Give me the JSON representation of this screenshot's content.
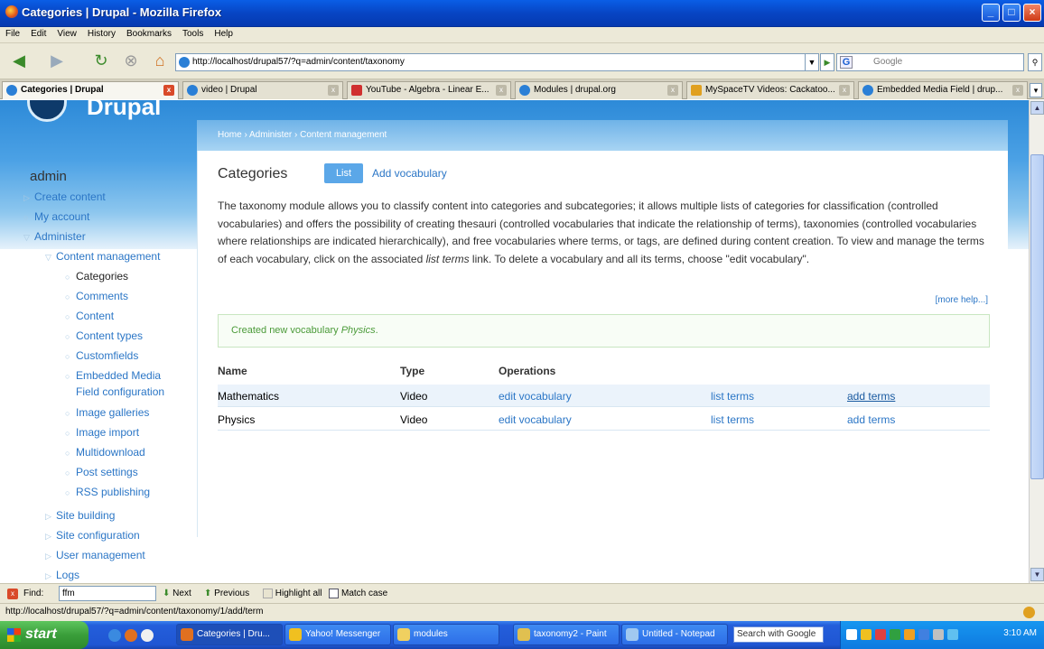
{
  "window": {
    "title": "Categories | Drupal - Mozilla Firefox"
  },
  "menu": [
    "File",
    "Edit",
    "View",
    "History",
    "Bookmarks",
    "Tools",
    "Help"
  ],
  "url": "http://localhost/drupal57/?q=admin/content/taxonomy",
  "search_placeholder": "Google",
  "tabs": [
    {
      "label": "Categories | Drupal"
    },
    {
      "label": "video | Drupal"
    },
    {
      "label": "YouTube - Algebra - Linear E..."
    },
    {
      "label": "Modules | drupal.org"
    },
    {
      "label": "MySpaceTV Videos: Cackatoo..."
    },
    {
      "label": "Embedded Media Field | drup..."
    }
  ],
  "site": {
    "logo_text": "Drupal"
  },
  "breadcrumb": "Home › Administer › Content management",
  "sidebar": {
    "user": "admin",
    "items": [
      {
        "label": "Create content"
      },
      {
        "label": "My account"
      },
      {
        "label": "Administer"
      },
      {
        "label": "Content management"
      },
      {
        "label": "Categories"
      },
      {
        "label": "Comments"
      },
      {
        "label": "Content"
      },
      {
        "label": "Content types"
      },
      {
        "label": "Customfields"
      },
      {
        "label": "Embedded Media"
      },
      {
        "label": "Field configuration"
      },
      {
        "label": "Image galleries"
      },
      {
        "label": "Image import"
      },
      {
        "label": "Multidownload"
      },
      {
        "label": "Post settings"
      },
      {
        "label": "RSS publishing"
      },
      {
        "label": "Site building"
      },
      {
        "label": "Site configuration"
      },
      {
        "label": "User management"
      },
      {
        "label": "Logs"
      }
    ]
  },
  "page": {
    "title": "Categories",
    "tab_list": "List",
    "tab_add": "Add vocabulary",
    "desc_1": "The taxonomy module allows you to classify content into categories and subcategories; it allows multiple lists of categories for classification (controlled vocabularies) and offers the possibility of creating thesauri (controlled vocabularies that indicate the relationship of terms), taxonomies (controlled vocabularies where relationships are indicated hierarchically), and free vocabularies where terms, or tags, are defined during content creation. To view and manage the terms of each vocabulary, click on the associated ",
    "desc_em": "list terms",
    "desc_2": " link. To delete a vocabulary and all its terms, choose \"edit vocabulary\".",
    "more_help": "[more help...]",
    "message_pre": "Created new vocabulary ",
    "message_em": "Physics",
    "message_post": ".",
    "table": {
      "headers": [
        "Name",
        "Type",
        "Operations"
      ],
      "rows": [
        {
          "name": "Mathematics",
          "type": "Video",
          "edit": "edit vocabulary",
          "list": "list terms",
          "add": "add terms"
        },
        {
          "name": "Physics",
          "type": "Video",
          "edit": "edit vocabulary",
          "list": "list terms",
          "add": "add terms"
        }
      ]
    }
  },
  "findbar": {
    "label": "Find:",
    "value": "ffm",
    "next": "Next",
    "previous": "Previous",
    "highlight": "Highlight all",
    "match_case": "Match case"
  },
  "status": "http://localhost/drupal57/?q=admin/content/taxonomy/1/add/term",
  "taskbar": {
    "start": "start",
    "items": [
      {
        "label": "Categories | Dru..."
      },
      {
        "label": "Yahoo! Messenger"
      },
      {
        "label": "modules"
      },
      {
        "label": "taxonomy2 - Paint"
      },
      {
        "label": "Untitled - Notepad"
      }
    ],
    "search": "Search with Google",
    "clock": "3:10 AM"
  }
}
